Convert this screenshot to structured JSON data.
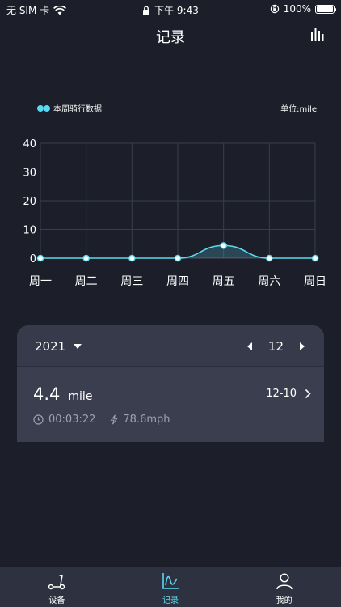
{
  "status": {
    "carrier": "无 SIM 卡",
    "time": "下午 9:43",
    "battery": "100%"
  },
  "header": {
    "title": "记录"
  },
  "legend": {
    "label": "本周骑行数据"
  },
  "unit": "单位:mile",
  "chart_data": {
    "type": "area",
    "categories": [
      "周一",
      "周二",
      "周三",
      "周四",
      "周五",
      "周六",
      "周日"
    ],
    "values": [
      0,
      0,
      0,
      0,
      4.4,
      0,
      0
    ],
    "ylim": [
      0,
      40
    ],
    "yticks": [
      0,
      10,
      20,
      30,
      40
    ],
    "grid": true,
    "color": "#5ad8f0"
  },
  "card": {
    "year": "2021",
    "month": "12",
    "record": {
      "distance": "4.4",
      "distance_unit": "mile",
      "date": "12-10",
      "duration": "00:03:22",
      "speed": "78.6mph"
    }
  },
  "tabs": [
    {
      "label": "设备",
      "icon": "scooter-icon",
      "active": false
    },
    {
      "label": "记录",
      "icon": "chart-icon",
      "active": true
    },
    {
      "label": "我的",
      "icon": "person-icon",
      "active": false
    }
  ]
}
